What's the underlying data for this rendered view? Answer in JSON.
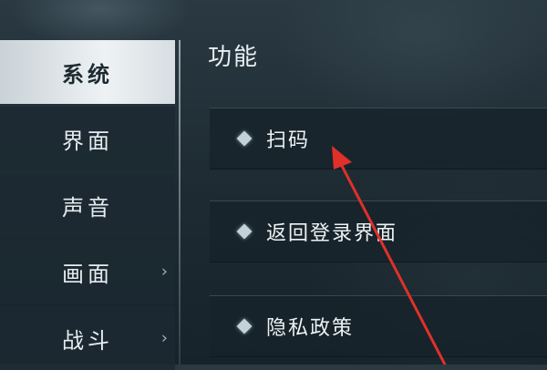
{
  "sidebar": {
    "items": [
      {
        "label": "系统",
        "active": true,
        "has_chevron": false
      },
      {
        "label": "界面",
        "active": false,
        "has_chevron": false
      },
      {
        "label": "声音",
        "active": false,
        "has_chevron": false
      },
      {
        "label": "画面",
        "active": false,
        "has_chevron": true
      },
      {
        "label": "战斗",
        "active": false,
        "has_chevron": true
      }
    ],
    "chevron_glyph": "›"
  },
  "main": {
    "section_title": "功能",
    "options": [
      {
        "label": "扫码",
        "icon": "diamond-bullet-icon"
      },
      {
        "label": "返回登录界面",
        "icon": "diamond-bullet-icon"
      },
      {
        "label": "隐私政策",
        "icon": "diamond-bullet-icon"
      }
    ]
  },
  "annotation": {
    "icon": "red-arrow-icon",
    "color": "#e0302a",
    "points_to": "扫码"
  },
  "colors": {
    "active_tab": "#e6ebee",
    "panel": "#16222a",
    "accent_arrow": "#e0302a"
  }
}
